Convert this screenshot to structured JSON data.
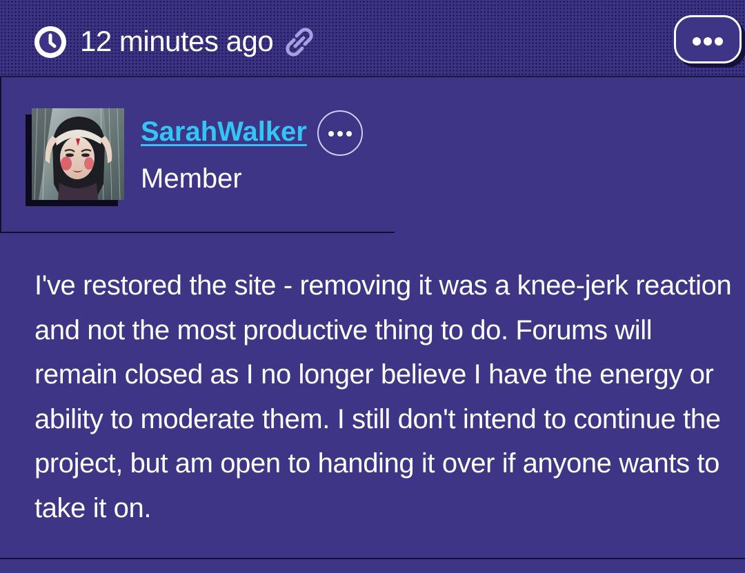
{
  "post": {
    "timestamp": "12 minutes ago",
    "author": {
      "username": "SarahWalker",
      "role": "Member"
    },
    "body": "I've restored the site - removing it was a knee-jerk reaction and not the most productive thing to do. Forums will remain closed as I no longer believe I have the energy or ability to moderate them. I still don't intend to continue the project, but am open to handing it over if anyone wants to take it on."
  },
  "icons": {
    "clock": "clock-icon",
    "link": "link-icon",
    "post_menu": "more-horizontal-icon",
    "user_menu": "more-horizontal-icon"
  },
  "colors": {
    "background": "#3f3586",
    "username": "#33c6f5",
    "text": "#ffffff",
    "link_icon": "#a79fe0"
  }
}
